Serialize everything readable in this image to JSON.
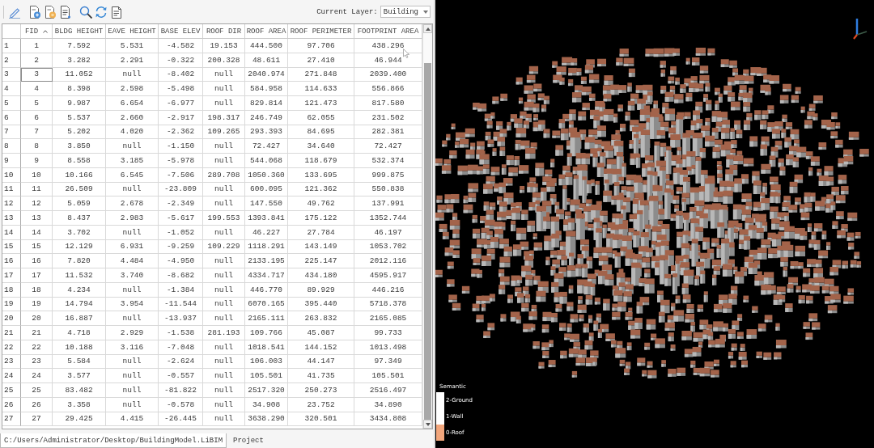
{
  "toolbar": {
    "current_layer": {
      "label": "Current Layer:",
      "value": "Building"
    }
  },
  "table": {
    "columns": [
      {
        "label": "FID",
        "sorted": true
      },
      {
        "label": "BLDG HEIGHT",
        "sorted": false
      },
      {
        "label": "EAVE HEIGHT",
        "sorted": false
      },
      {
        "label": "BASE ELEV",
        "sorted": false
      },
      {
        "label": "ROOF DIR",
        "sorted": false
      },
      {
        "label": "ROOF AREA",
        "sorted": false
      },
      {
        "label": "ROOF PERIMETER",
        "sorted": false
      },
      {
        "label": "FOOTPRINT AREA",
        "sorted": false
      }
    ],
    "rows": [
      {
        "header": "1",
        "current": false,
        "cells": [
          "1",
          "7.592",
          "5.531",
          "-4.582",
          "19.153",
          "444.500",
          "97.706",
          "438.296"
        ]
      },
      {
        "header": "2",
        "current": false,
        "cells": [
          "2",
          "3.282",
          "2.291",
          "-0.322",
          "200.328",
          "48.611",
          "27.410",
          "46.944"
        ]
      },
      {
        "header": "3",
        "current": true,
        "cells": [
          "3",
          "11.052",
          "null",
          "-8.402",
          "null",
          "2040.974",
          "271.848",
          "2039.400"
        ]
      },
      {
        "header": "4",
        "current": false,
        "cells": [
          "4",
          "8.398",
          "2.598",
          "-5.498",
          "null",
          "584.958",
          "114.633",
          "556.866"
        ]
      },
      {
        "header": "5",
        "current": false,
        "cells": [
          "5",
          "9.987",
          "6.654",
          "-6.977",
          "null",
          "829.814",
          "121.473",
          "817.580"
        ]
      },
      {
        "header": "6",
        "current": false,
        "cells": [
          "6",
          "5.537",
          "2.660",
          "-2.917",
          "198.317",
          "246.749",
          "62.055",
          "231.502"
        ]
      },
      {
        "header": "7",
        "current": false,
        "cells": [
          "7",
          "5.202",
          "4.020",
          "-2.362",
          "109.265",
          "293.393",
          "84.695",
          "282.381"
        ]
      },
      {
        "header": "8",
        "current": false,
        "cells": [
          "8",
          "3.850",
          "null",
          "-1.150",
          "null",
          "72.427",
          "34.640",
          "72.427"
        ]
      },
      {
        "header": "9",
        "current": false,
        "cells": [
          "9",
          "8.558",
          "3.185",
          "-5.978",
          "null",
          "544.068",
          "118.679",
          "532.374"
        ]
      },
      {
        "header": "10",
        "current": false,
        "cells": [
          "10",
          "10.166",
          "6.545",
          "-7.506",
          "289.708",
          "1050.360",
          "133.695",
          "999.875"
        ]
      },
      {
        "header": "11",
        "current": false,
        "cells": [
          "11",
          "26.509",
          "null",
          "-23.809",
          "null",
          "600.095",
          "121.362",
          "550.838"
        ]
      },
      {
        "header": "12",
        "current": false,
        "cells": [
          "12",
          "5.059",
          "2.678",
          "-2.349",
          "null",
          "147.550",
          "49.762",
          "137.991"
        ]
      },
      {
        "header": "13",
        "current": false,
        "cells": [
          "13",
          "8.437",
          "2.983",
          "-5.617",
          "199.553",
          "1393.841",
          "175.122",
          "1352.744"
        ]
      },
      {
        "header": "14",
        "current": false,
        "cells": [
          "14",
          "3.702",
          "null",
          "-1.052",
          "null",
          "46.227",
          "27.784",
          "46.197"
        ]
      },
      {
        "header": "15",
        "current": false,
        "cells": [
          "15",
          "12.129",
          "6.931",
          "-9.259",
          "109.229",
          "1118.291",
          "143.149",
          "1053.702"
        ]
      },
      {
        "header": "16",
        "current": false,
        "cells": [
          "16",
          "7.820",
          "4.484",
          "-4.950",
          "null",
          "2133.195",
          "225.147",
          "2012.116"
        ]
      },
      {
        "header": "17",
        "current": false,
        "cells": [
          "17",
          "11.532",
          "3.740",
          "-8.682",
          "null",
          "4334.717",
          "434.180",
          "4595.917"
        ]
      },
      {
        "header": "18",
        "current": false,
        "cells": [
          "18",
          "4.234",
          "null",
          "-1.384",
          "null",
          "446.770",
          "89.929",
          "446.216"
        ]
      },
      {
        "header": "19",
        "current": false,
        "cells": [
          "19",
          "14.794",
          "3.954",
          "-11.544",
          "null",
          "6070.165",
          "395.440",
          "5718.378"
        ]
      },
      {
        "header": "20",
        "current": false,
        "cells": [
          "20",
          "16.887",
          "null",
          "-13.937",
          "null",
          "2165.111",
          "263.832",
          "2165.085"
        ]
      },
      {
        "header": "21",
        "current": false,
        "cells": [
          "21",
          "4.718",
          "2.929",
          "-1.538",
          "281.193",
          "109.766",
          "45.087",
          "99.733"
        ]
      },
      {
        "header": "22",
        "current": false,
        "cells": [
          "22",
          "10.188",
          "3.116",
          "-7.048",
          "null",
          "1018.541",
          "144.152",
          "1013.498"
        ]
      },
      {
        "header": "23",
        "current": false,
        "cells": [
          "23",
          "5.584",
          "null",
          "-2.624",
          "null",
          "106.003",
          "44.147",
          "97.349"
        ]
      },
      {
        "header": "24",
        "current": false,
        "cells": [
          "24",
          "3.577",
          "null",
          "-0.557",
          "null",
          "105.501",
          "41.735",
          "105.501"
        ]
      },
      {
        "header": "25",
        "current": false,
        "cells": [
          "25",
          "83.482",
          "null",
          "-81.822",
          "null",
          "2517.320",
          "250.273",
          "2516.497"
        ]
      },
      {
        "header": "26",
        "current": false,
        "cells": [
          "26",
          "3.358",
          "null",
          "-0.578",
          "null",
          "34.908",
          "23.752",
          "34.890"
        ]
      },
      {
        "header": "27",
        "current": false,
        "cells": [
          "27",
          "29.425",
          "4.415",
          "-26.445",
          "null",
          "3638.290",
          "320.501",
          "3434.808"
        ]
      }
    ]
  },
  "file_tabs": [
    {
      "label": "C:/Users/Administrator/Desktop/BuildingModel.LiBIM",
      "selected": true
    },
    {
      "label": "Project",
      "selected": false
    }
  ],
  "viewport": {
    "legend": {
      "title": "Semantic",
      "items": [
        {
          "label": "2-Ground",
          "color": "#ffffff"
        },
        {
          "label": "1-Wall",
          "color": "#ffffff"
        },
        {
          "label": "0-Roof",
          "color": "#f2a67c"
        }
      ]
    }
  }
}
